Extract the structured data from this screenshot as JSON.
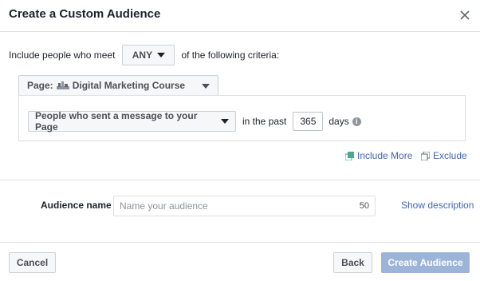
{
  "dialog": {
    "title": "Create a Custom Audience",
    "close_icon": "close-icon"
  },
  "criteria": {
    "prefix": "Include people who meet",
    "match_value": "ANY",
    "suffix": "of the following criteria:"
  },
  "page_selector": {
    "label": "Page:",
    "page_icon": "page-flag-icon",
    "value": "Digital Marketing Course"
  },
  "rule": {
    "event": "People who sent a message to your Page",
    "in_the_past": "in the past",
    "days_value": "365",
    "days_label": "days",
    "info_icon": "info-icon"
  },
  "actions": {
    "include_more": "Include More",
    "exclude": "Exclude"
  },
  "audience_name": {
    "label": "Audience name",
    "placeholder": "Name your audience",
    "counter": "50",
    "show_description": "Show description"
  },
  "footer": {
    "cancel": "Cancel",
    "back": "Back",
    "create": "Create Audience"
  },
  "colors": {
    "link": "#4267b2",
    "create_disabled": "#9cb4d8",
    "border": "#dddfe2"
  }
}
